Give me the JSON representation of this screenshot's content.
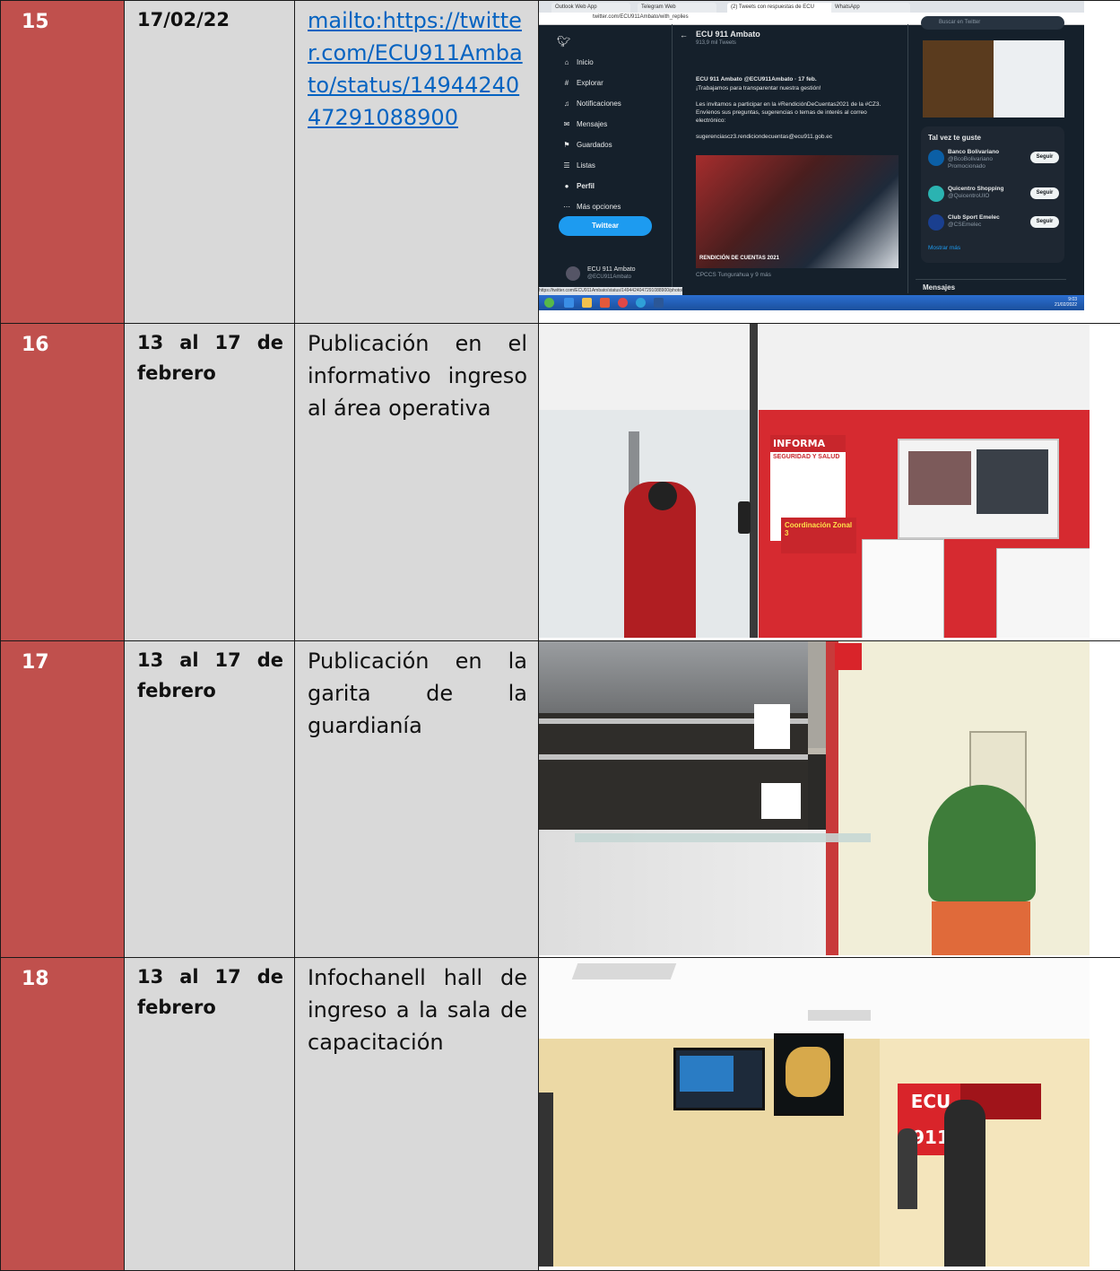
{
  "rows": [
    {
      "num": "15",
      "date": "17/02/22",
      "description": "mailto:https://twitter.com/ECU911Ambato/status/1494424047291088900",
      "is_link": true
    },
    {
      "num": "16",
      "date": "13 al 17 de febrero",
      "description": "Publicación en el informativo ingreso al área operativa",
      "is_link": false
    },
    {
      "num": "17",
      "date": "13 al 17 de febrero",
      "description": "Publicación en la garita de la guardianía",
      "is_link": false
    },
    {
      "num": "18",
      "date": "13 al 17 de febrero",
      "description": "Infochanell hall de ingreso a la sala de capacitación",
      "is_link": false
    }
  ],
  "screenshot": {
    "tabs": [
      "Outlook Web App",
      "Telegram Web",
      "(2) Tweets con respuestas de ECU",
      "WhatsApp"
    ],
    "address": "twitter.com/ECU911Ambato/with_replies",
    "nav": [
      {
        "icon": "home-icon",
        "glyph": "⌂",
        "label": "Inicio"
      },
      {
        "icon": "hashtag-icon",
        "glyph": "#",
        "label": "Explorar"
      },
      {
        "icon": "bell-icon",
        "glyph": "♫",
        "label": "Notificaciones"
      },
      {
        "icon": "mail-icon",
        "glyph": "✉",
        "label": "Mensajes"
      },
      {
        "icon": "bookmark-icon",
        "glyph": "⚑",
        "label": "Guardados"
      },
      {
        "icon": "list-icon",
        "glyph": "☰",
        "label": "Listas"
      },
      {
        "icon": "person-icon",
        "glyph": "●",
        "label": "Perfil"
      },
      {
        "icon": "more-icon",
        "glyph": "⋯",
        "label": "Más opciones"
      }
    ],
    "tweet_button": "Twittear",
    "profile_name": "ECU 911 Ambato",
    "profile_handle": "@ECU911Ambato",
    "header_title": "ECU 911 Ambato",
    "header_sub": "913,9 mil Tweets",
    "tweet_author": "ECU 911 Ambato @ECU911Ambato · 17 feb.",
    "tweet_lines": [
      "¡Trabajamos para transparentar nuestra gestión!",
      "Les invitamos a participar en la #RendiciónDeCuentas2021 de la #CZ3.",
      "Envíenos sus preguntas, sugerencias o temas de interés al correo",
      "electrónico:",
      "sugerenciascz3.rendiciondecuentas@ecu911.gob.ec"
    ],
    "image_caption": "RENDICIÓN DE CUENTAS 2021",
    "image_footer": "CPCCS Tungurahua y 9 más",
    "search_placeholder": "Buscar en Twitter",
    "suggest_title": "Tal vez te guste",
    "suggestions": [
      {
        "name": "Banco Bolivariano",
        "handle": "@BcoBolivariano",
        "note": "Promocionado",
        "button": "Seguir",
        "color": "#0b5fa6"
      },
      {
        "name": "Quicentro Shopping",
        "handle": "@QuicentroUIO",
        "note": "",
        "button": "Seguir",
        "color": "#2bb3b1"
      },
      {
        "name": "Club Sport Emelec",
        "handle": "@CSEmelec",
        "note": "",
        "button": "Seguir",
        "color": "#1a3f8f"
      }
    ],
    "show_more": "Mostrar más",
    "messages": "Mensajes",
    "status_url": "https://twitter.com/ECU911Ambato/status/1494424047291088900/photo/1",
    "clock_time": "9:03",
    "clock_date": "21/02/2022"
  },
  "photo_labels": {
    "row16_sign": "INFORMA",
    "row16_sign_sub": "SEGURIDAD Y SALUD",
    "row16_poster": "Coordinación Zonal 3",
    "row18_logo": "ECU",
    "row18_logo_num": "911"
  },
  "colors": {
    "number_cell": "#c0504d",
    "text_cells": "#d9d9d9",
    "link": "#0563c1"
  }
}
